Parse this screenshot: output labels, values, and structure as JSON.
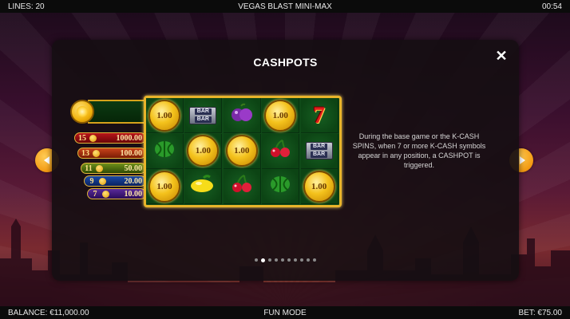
{
  "topbar": {
    "lines": "LINES: 20",
    "title": "VEGAS BLAST MINI-MAX",
    "time": "00:54"
  },
  "bottombar": {
    "balance": "BALANCE: €11,000.00",
    "mode": "FUN MODE",
    "bet": "BET: €75.00"
  },
  "panel": {
    "title": "CASHPOTS",
    "close": "✕",
    "description": "During the base game or the K-CASH SPINS, when 7 or more K-CASH symbols appear in any position, a CASHPOT is triggered.",
    "pagination": {
      "total": 10,
      "current": 2
    }
  },
  "cashpots": [
    {
      "count": "15",
      "amount": "1000.00"
    },
    {
      "count": "13",
      "amount": "100.00"
    },
    {
      "count": "11",
      "amount": "50.00"
    },
    {
      "count": "9",
      "amount": "20.00"
    },
    {
      "count": "7",
      "amount": "10.00"
    }
  ],
  "reels": {
    "coin_value": "1.00",
    "bar_text": [
      "BAR",
      "BAR"
    ],
    "grid": [
      [
        "coin",
        "bar",
        "plum",
        "coin",
        "seven"
      ],
      [
        "melon",
        "coin",
        "coin",
        "cherry",
        "bar"
      ],
      [
        "coin",
        "lemon",
        "cherry",
        "melon",
        "coin"
      ]
    ]
  },
  "colors": {
    "accent": "#f39a12",
    "reel_frame": "#e8b42a",
    "reel_bg": "#0f4a18"
  }
}
